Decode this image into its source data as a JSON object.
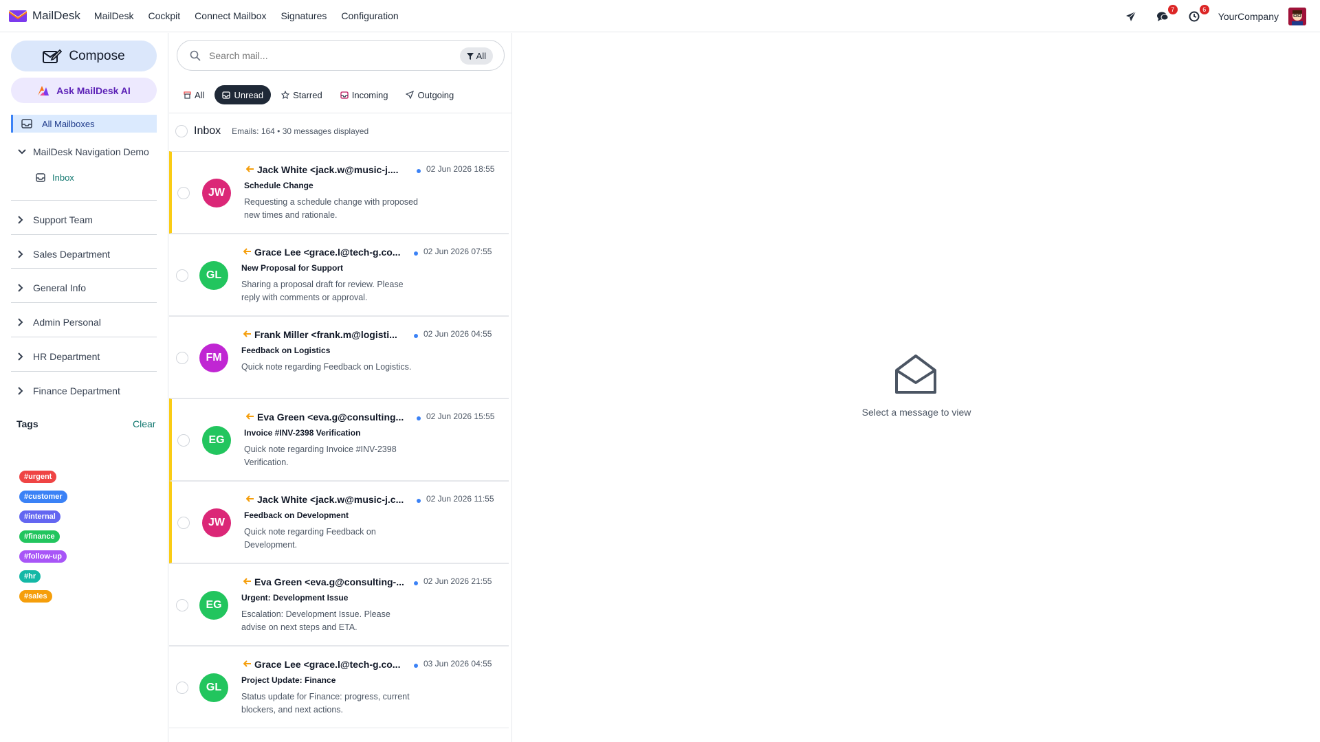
{
  "brand": {
    "name": "MailDesk"
  },
  "topnav": [
    "MailDesk",
    "Cockpit",
    "Connect Mailbox",
    "Signatures",
    "Configuration"
  ],
  "topright": {
    "chat_count": "7",
    "activity_count": "6",
    "company": "YourCompany"
  },
  "sidebar": {
    "compose_label": "Compose",
    "ai_label": "Ask MailDesk AI",
    "all_mailboxes": "All Mailboxes",
    "demo_group": "MailDesk Navigation Demo",
    "inbox": "Inbox",
    "groups": [
      "Support Team",
      "Sales Department",
      "General Info",
      "Admin Personal",
      "HR Department",
      "Finance Department"
    ],
    "tags_title": "Tags",
    "tags_clear": "Clear",
    "tags": [
      {
        "label": "#urgent",
        "color": "#ef4444"
      },
      {
        "label": "#customer",
        "color": "#3b82f6"
      },
      {
        "label": "#internal",
        "color": "#6366f1"
      },
      {
        "label": "#finance",
        "color": "#22c55e"
      },
      {
        "label": "#follow-up",
        "color": "#a855f7"
      },
      {
        "label": "#hr",
        "color": "#14b8a6"
      },
      {
        "label": "#sales",
        "color": "#f59e0b"
      }
    ]
  },
  "list": {
    "search_placeholder": "Search mail...",
    "filter_label": "All",
    "tabs": [
      "All",
      "Unread",
      "Starred",
      "Incoming",
      "Outgoing"
    ],
    "active_tab": "Unread",
    "inbox_title": "Inbox",
    "inbox_meta": "Emails: 164 • 30 messages displayed",
    "messages": [
      {
        "initials": "JW",
        "color": "#db2777",
        "flag": true,
        "from": "Jack White <jack.w@music-j....",
        "date": "02 Jun 2026 18:55",
        "subject": "Schedule Change",
        "preview": "Requesting a schedule change with proposed new times and rationale."
      },
      {
        "initials": "GL",
        "color": "#22c55e",
        "flag": false,
        "from": "Grace Lee <grace.l@tech-g.co...",
        "date": "02 Jun 2026 07:55",
        "subject": "New Proposal for Support",
        "preview": "Sharing a proposal draft for review. Please reply with comments or approval."
      },
      {
        "initials": "FM",
        "color": "#c026d3",
        "flag": false,
        "from": "Frank Miller <frank.m@logisti...",
        "date": "02 Jun 2026 04:55",
        "subject": "Feedback on Logistics",
        "preview": "Quick note regarding Feedback on Logistics."
      },
      {
        "initials": "EG",
        "color": "#22c55e",
        "flag": true,
        "from": "Eva Green <eva.g@consulting...",
        "date": "02 Jun 2026 15:55",
        "subject": "Invoice #INV-2398 Verification",
        "preview": "Quick note regarding Invoice #INV-2398 Verification."
      },
      {
        "initials": "JW",
        "color": "#db2777",
        "flag": true,
        "from": "Jack White <jack.w@music-j.c...",
        "date": "02 Jun 2026 11:55",
        "subject": "Feedback on Development",
        "preview": "Quick note regarding Feedback on Development."
      },
      {
        "initials": "EG",
        "color": "#22c55e",
        "flag": false,
        "from": "Eva Green <eva.g@consulting-...",
        "date": "02 Jun 2026 21:55",
        "subject": "Urgent: Development Issue",
        "preview": "Escalation: Development Issue. Please advise on next steps and ETA."
      },
      {
        "initials": "GL",
        "color": "#22c55e",
        "flag": false,
        "from": "Grace Lee <grace.l@tech-g.co...",
        "date": "03 Jun 2026 04:55",
        "subject": "Project Update: Finance",
        "preview": "Status update for Finance: progress, current blockers, and next actions."
      }
    ]
  },
  "reader": {
    "empty_text": "Select a message to view"
  }
}
